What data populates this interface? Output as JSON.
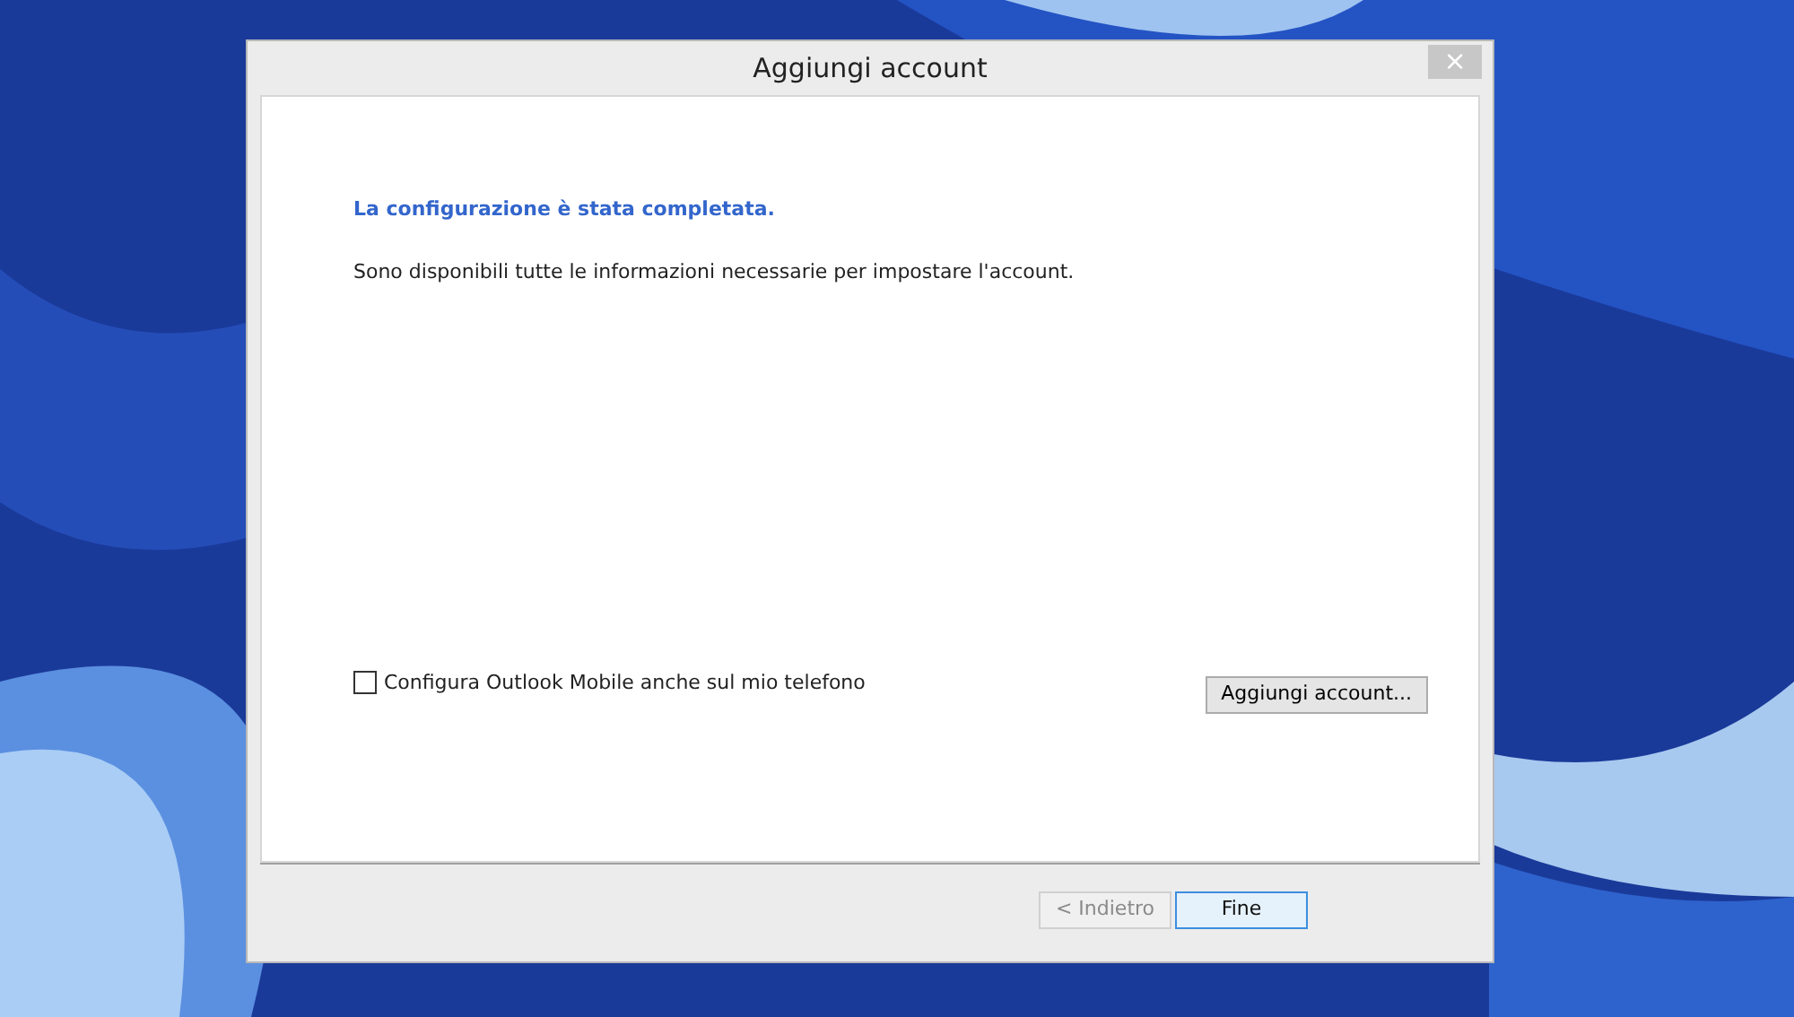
{
  "window": {
    "title": "Aggiungi account",
    "close": "×"
  },
  "heading": "La configurazione è stata completata.",
  "message": "Sono disponibili tutte le informazioni necessarie per impostare l'account.",
  "mobile_option": {
    "label": "Configura Outlook Mobile anche sul mio telefono",
    "checked": false
  },
  "add_button": "Aggiungi account...",
  "buttons": [
    {
      "label": "< Indietro",
      "disabled": true,
      "default": false
    },
    {
      "label": "Fine",
      "disabled": false,
      "default": true
    }
  ]
}
